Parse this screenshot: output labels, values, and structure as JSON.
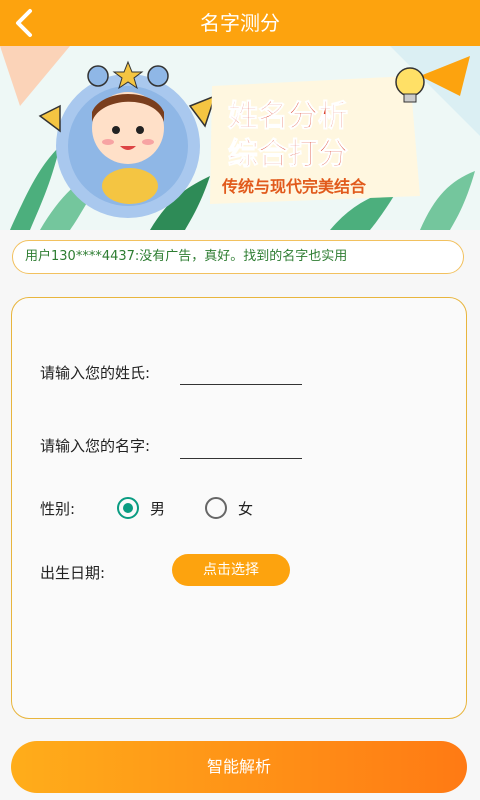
{
  "header": {
    "title": "名字测分",
    "back_icon": "chevron-left-icon"
  },
  "banner": {
    "line1": "姓名分析",
    "line2": "综合打分",
    "tagline": "传统与现代完美结合"
  },
  "ticker": {
    "text": "用户130****4437:没有广告，真好。找到的名字也实用"
  },
  "form": {
    "surname_label": "请输入您的姓氏:",
    "surname_value": "",
    "name_label": "请输入您的名字:",
    "name_value": "",
    "gender_label": "性别:",
    "gender_options": [
      {
        "label": "男",
        "selected": true
      },
      {
        "label": "女",
        "selected": false
      }
    ],
    "birth_label": "出生日期:",
    "birth_button": "点击选择"
  },
  "actions": {
    "analyze_button": "智能解析"
  },
  "colors": {
    "primary": "#fda30e",
    "accent": "#0a9c82",
    "border": "#e8b53d"
  }
}
